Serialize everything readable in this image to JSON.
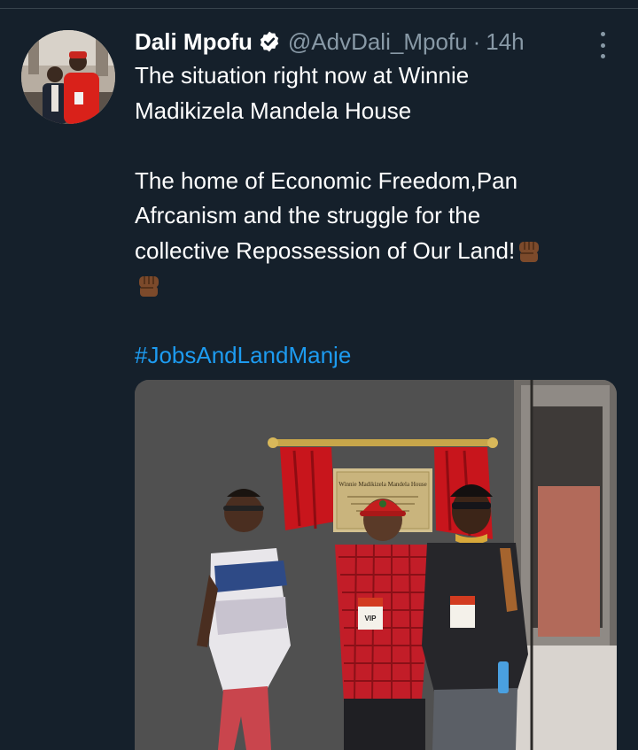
{
  "tweet": {
    "author_name": "Dali Mpofu",
    "author_handle": "@AdvDali_Mpofu",
    "separator": "·",
    "timestamp": "14h",
    "verified": true,
    "text_lines": [
      "The situation right now at Winnie",
      "Madikizela Mandela House",
      "",
      "The home of Economic Freedom,Pan",
      "Afrcanism and the struggle for the",
      "collective Repossession of Our Land!"
    ],
    "emoji_name": "raised-fist-medium-dark-skin-tone",
    "hashtag": "#JobsAndLandManje"
  },
  "media": {
    "plaque_title": "Winnie Madikizela Mandela House",
    "lanyard_badge": "VIP"
  },
  "colors": {
    "background": "#15202b",
    "text": "#ffffff",
    "secondary": "#8899a6",
    "link": "#1d9bf0",
    "verified": "#ffffff"
  }
}
